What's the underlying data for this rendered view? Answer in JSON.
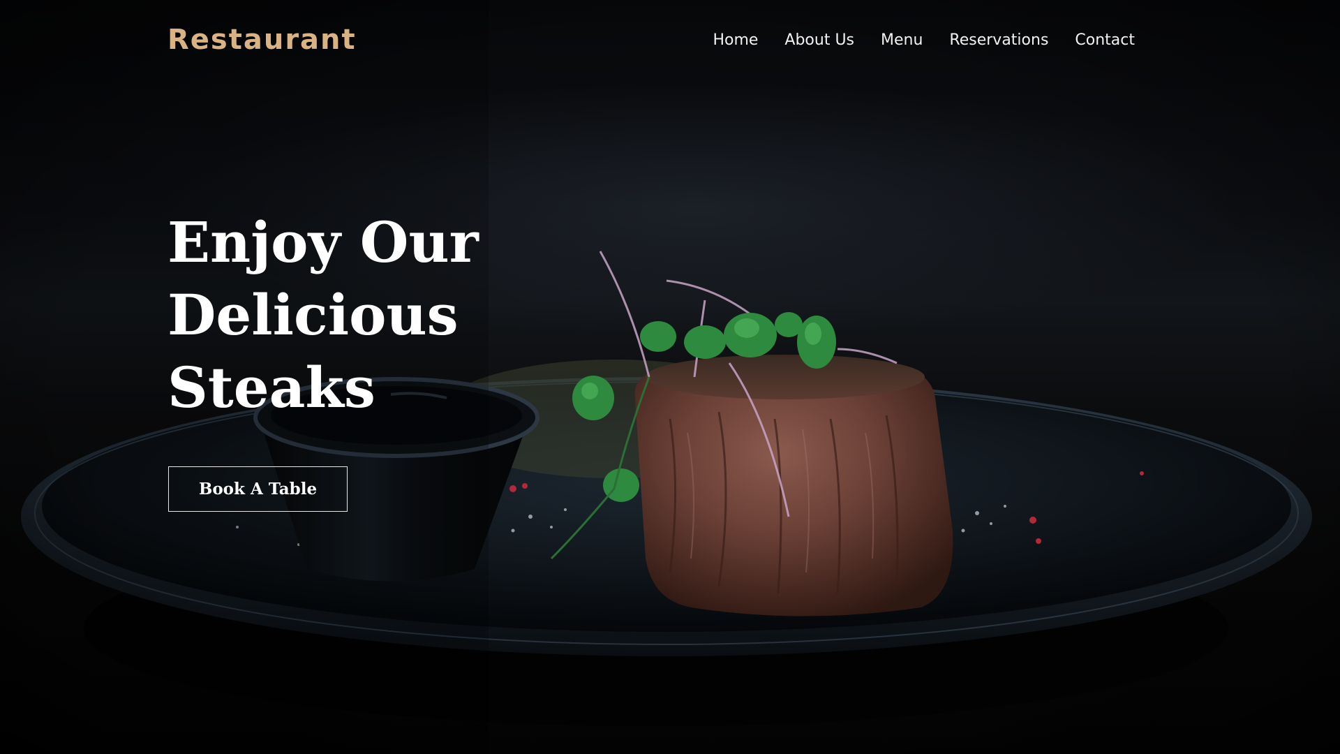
{
  "header": {
    "brand": "Restaurant",
    "nav": [
      {
        "label": "Home"
      },
      {
        "label": "About Us"
      },
      {
        "label": "Menu"
      },
      {
        "label": "Reservations"
      },
      {
        "label": "Contact"
      }
    ]
  },
  "hero": {
    "title_lines": [
      "Enjoy Our",
      "Delicious",
      "Steaks"
    ],
    "cta_label": "Book A Table",
    "image": "steak-on-dark-plate-photo"
  },
  "colors": {
    "brand": "#d9b383",
    "background": "#050607",
    "text": "#ffffff"
  }
}
